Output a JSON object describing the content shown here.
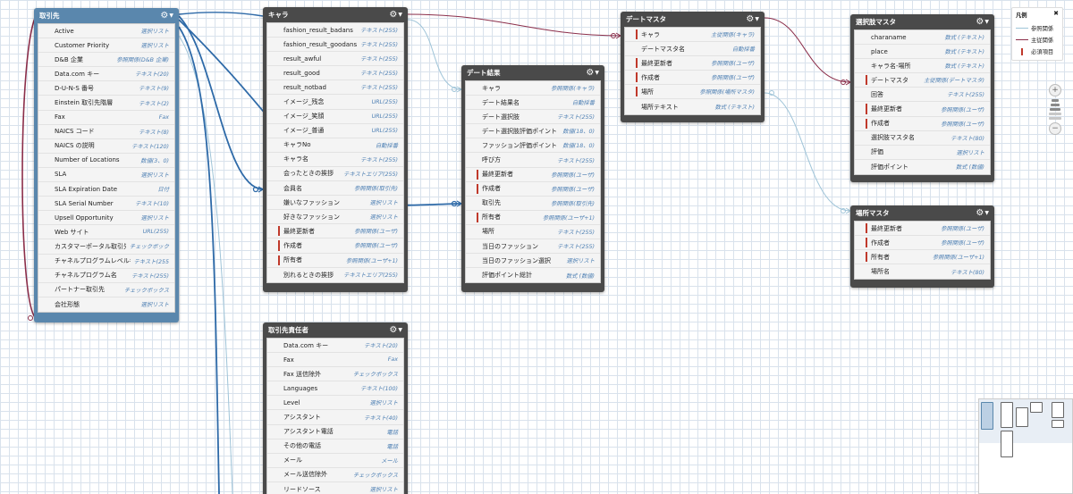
{
  "legend": {
    "title": "凡例",
    "close": "✖",
    "items": [
      {
        "label": "参照関係",
        "color": "#9fc4d8"
      },
      {
        "label": "主従関係",
        "color": "#8b2e4a"
      },
      {
        "label": "必須項目",
        "color": "#c0392b"
      }
    ]
  },
  "zoom": {
    "in": "+",
    "out": "−"
  },
  "objects": {
    "torihikisaki": {
      "title": "取引先",
      "fields": [
        {
          "name": "Active",
          "type": "選択リスト"
        },
        {
          "name": "Customer Priority",
          "type": "選択リスト"
        },
        {
          "name": "D&B 企業",
          "type": "参照関係(D&B 企業)"
        },
        {
          "name": "Data.com キー",
          "type": "テキスト(20)"
        },
        {
          "name": "D-U-N-S 番号",
          "type": "テキスト(9)"
        },
        {
          "name": "Einstein 取引先階層",
          "type": "テキスト(2)"
        },
        {
          "name": "Fax",
          "type": "Fax"
        },
        {
          "name": "NAICS コード",
          "type": "テキスト(8)"
        },
        {
          "name": "NAICS の説明",
          "type": "テキスト(120)"
        },
        {
          "name": "Number of Locations",
          "type": "数値(3、0)"
        },
        {
          "name": "SLA",
          "type": "選択リスト"
        },
        {
          "name": "SLA Expiration Date",
          "type": "日付"
        },
        {
          "name": "SLA Serial Number",
          "type": "テキスト(10)"
        },
        {
          "name": "Upsell Opportunity",
          "type": "選択リスト"
        },
        {
          "name": "Web サイト",
          "type": "URL(255)"
        },
        {
          "name": "カスタマーポータル取引先",
          "type": "チェックボック"
        },
        {
          "name": "チャネルプログラムレベル名",
          "type": "テキスト(255"
        },
        {
          "name": "チャネルプログラム名",
          "type": "テキスト(255)"
        },
        {
          "name": "パートナー取引先",
          "type": "チェックボックス"
        },
        {
          "name": "会社形態",
          "type": "選択リスト"
        }
      ]
    },
    "kyara": {
      "title": "キャラ",
      "fields": [
        {
          "name": "fashion_result_badans",
          "type": "テキスト(255)"
        },
        {
          "name": "fashion_result_goodans",
          "type": "テキスト(255)"
        },
        {
          "name": "result_awful",
          "type": "テキスト(255)"
        },
        {
          "name": "result_good",
          "type": "テキスト(255)"
        },
        {
          "name": "result_notbad",
          "type": "テキスト(255)"
        },
        {
          "name": "イメージ_残念",
          "type": "URL(255)"
        },
        {
          "name": "イメージ_笑顔",
          "type": "URL(255)"
        },
        {
          "name": "イメージ_普通",
          "type": "URL(255)"
        },
        {
          "name": "キャラNo",
          "type": "自動採番"
        },
        {
          "name": "キャラ名",
          "type": "テキスト(255)"
        },
        {
          "name": "会ったときの挨拶",
          "type": "テキストエリア(255)"
        },
        {
          "name": "会員名",
          "type": "参照関係(取引先)"
        },
        {
          "name": "嫌いなファッション",
          "type": "選択リスト"
        },
        {
          "name": "好きなファッション",
          "type": "選択リスト"
        },
        {
          "name": "最終更新者",
          "type": "参照関係(ユーザ)",
          "req": true
        },
        {
          "name": "作成者",
          "type": "参照関係(ユーザ)",
          "req": true
        },
        {
          "name": "所有者",
          "type": "参照関係(ユーザ+1)",
          "req": true
        },
        {
          "name": "別れるときの挨拶",
          "type": "テキストエリア(255)"
        }
      ]
    },
    "torihikisaki_sekininsha": {
      "title": "取引先責任者",
      "fields": [
        {
          "name": "Data.com キー",
          "type": "テキスト(20)"
        },
        {
          "name": "Fax",
          "type": "Fax"
        },
        {
          "name": "Fax 送信除外",
          "type": "チェックボックス"
        },
        {
          "name": "Languages",
          "type": "テキスト(100)"
        },
        {
          "name": "Level",
          "type": "選択リスト"
        },
        {
          "name": "アシスタント",
          "type": "テキスト(40)"
        },
        {
          "name": "アシスタント電話",
          "type": "電話"
        },
        {
          "name": "その他の電話",
          "type": "電話"
        },
        {
          "name": "メール",
          "type": "メール"
        },
        {
          "name": "メール送信除外",
          "type": "チェックボックス"
        },
        {
          "name": "リードソース",
          "type": "選択リスト"
        }
      ]
    },
    "date_kekka": {
      "title": "デート結果",
      "fields": [
        {
          "name": "キャラ",
          "type": "参照関係(キャラ)"
        },
        {
          "name": "デート結果名",
          "type": "自動採番"
        },
        {
          "name": "デート選択肢",
          "type": "テキスト(255)"
        },
        {
          "name": "デート選択肢評価ポイント",
          "type": "数値(18、0)"
        },
        {
          "name": "ファッション評価ポイント",
          "type": "数値(18、0)"
        },
        {
          "name": "呼び方",
          "type": "テキスト(255)"
        },
        {
          "name": "最終更新者",
          "type": "参照関係(ユーザ)",
          "req": true
        },
        {
          "name": "作成者",
          "type": "参照関係(ユーザ)",
          "req": true
        },
        {
          "name": "取引先",
          "type": "参照関係(取引先)"
        },
        {
          "name": "所有者",
          "type": "参照関係(ユーザ+1)",
          "req": true
        },
        {
          "name": "場所",
          "type": "テキスト(255)"
        },
        {
          "name": "当日のファッション",
          "type": "テキスト(255)"
        },
        {
          "name": "当日のファッション選択",
          "type": "選択リスト"
        },
        {
          "name": "評価ポイント総計",
          "type": "数式 (数値)"
        }
      ]
    },
    "date_master": {
      "title": "デートマスタ",
      "fields": [
        {
          "name": "キャラ",
          "type": "主従関係(キャラ)",
          "req": true
        },
        {
          "name": "デートマスタ名",
          "type": "自動採番"
        },
        {
          "name": "最終更新者",
          "type": "参照関係(ユーザ)",
          "req": true
        },
        {
          "name": "作成者",
          "type": "参照関係(ユーザ)",
          "req": true
        },
        {
          "name": "場所",
          "type": "参照関係(場所マスタ)",
          "req": true
        },
        {
          "name": "場所テキスト",
          "type": "数式 (テキスト)"
        }
      ]
    },
    "sentakushi_master": {
      "title": "選択肢マスタ",
      "fields": [
        {
          "name": "charaname",
          "type": "数式 (テキスト)"
        },
        {
          "name": "place",
          "type": "数式 (テキスト)"
        },
        {
          "name": "キャラ名-場所",
          "type": "数式 (テキスト)"
        },
        {
          "name": "デートマスタ",
          "type": "主従関係(デートマスタ)",
          "req": true
        },
        {
          "name": "回答",
          "type": "テキスト(255)"
        },
        {
          "name": "最終更新者",
          "type": "参照関係(ユーザ)",
          "req": true
        },
        {
          "name": "作成者",
          "type": "参照関係(ユーザ)",
          "req": true
        },
        {
          "name": "選択肢マスタ名",
          "type": "テキスト(80)"
        },
        {
          "name": "評価",
          "type": "選択リスト"
        },
        {
          "name": "評価ポイント",
          "type": "数式 (数値)"
        }
      ]
    },
    "basho_master": {
      "title": "場所マスタ",
      "fields": [
        {
          "name": "最終更新者",
          "type": "参照関係(ユーザ)",
          "req": true
        },
        {
          "name": "作成者",
          "type": "参照関係(ユーザ)",
          "req": true
        },
        {
          "name": "所有者",
          "type": "参照関係(ユーザ+1)",
          "req": true
        },
        {
          "name": "場所名",
          "type": "テキスト(80)"
        }
      ]
    }
  }
}
